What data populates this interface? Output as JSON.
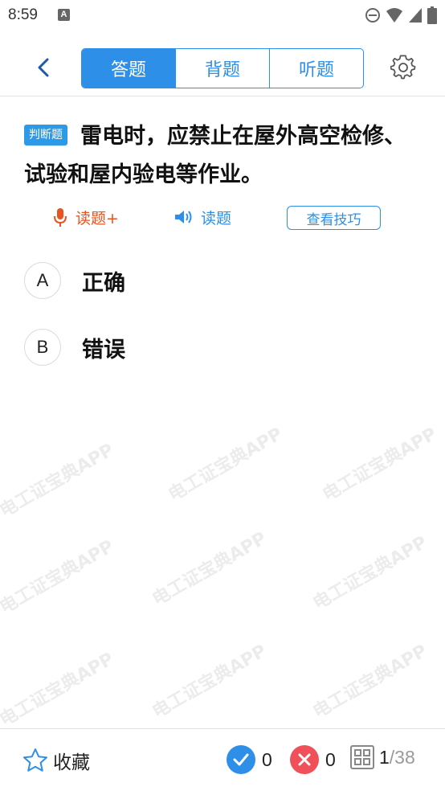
{
  "status_bar": {
    "time": "8:59",
    "app_icon_letter": "A"
  },
  "header": {
    "tabs": [
      {
        "label": "答题",
        "active": true
      },
      {
        "label": "背题",
        "active": false
      },
      {
        "label": "听题",
        "active": false
      }
    ]
  },
  "question": {
    "type_badge": "判断题",
    "text": "雷电时，应禁止在屋外高空检修、试验和屋内验电等作业。",
    "tools": {
      "read_plus": "读题+",
      "read": "读题",
      "tips": "查看技巧"
    },
    "options": [
      {
        "letter": "A",
        "text": "正确"
      },
      {
        "letter": "B",
        "text": "错误"
      }
    ]
  },
  "watermark_text": "电工证宝典APP",
  "bottom_bar": {
    "favorite_label": "收藏",
    "correct_count": "0",
    "wrong_count": "0",
    "current": "1",
    "total": "/38"
  },
  "colors": {
    "accent": "#2d8fe8",
    "read_plus": "#e8531f",
    "correct": "#2d8fe8",
    "wrong": "#f0505a"
  }
}
